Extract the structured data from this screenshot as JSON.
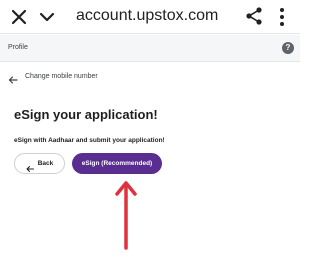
{
  "browser": {
    "url": "account.upstox.com",
    "icons": [
      "close-icon",
      "chevron-down-icon",
      "share-icon",
      "more-vert-icon"
    ]
  },
  "header": {
    "title": "Profile",
    "help_icon": "?"
  },
  "nav": {
    "back_label": "Change mobile number"
  },
  "main": {
    "title": "eSign your application!",
    "subtitle": "eSign with Aadhaar and submit your application!",
    "back_button_label": "Back",
    "esign_button_label": "eSign (Recommended)"
  },
  "colors": {
    "primary": "#5a2d91",
    "annotation": "#e0323c"
  }
}
